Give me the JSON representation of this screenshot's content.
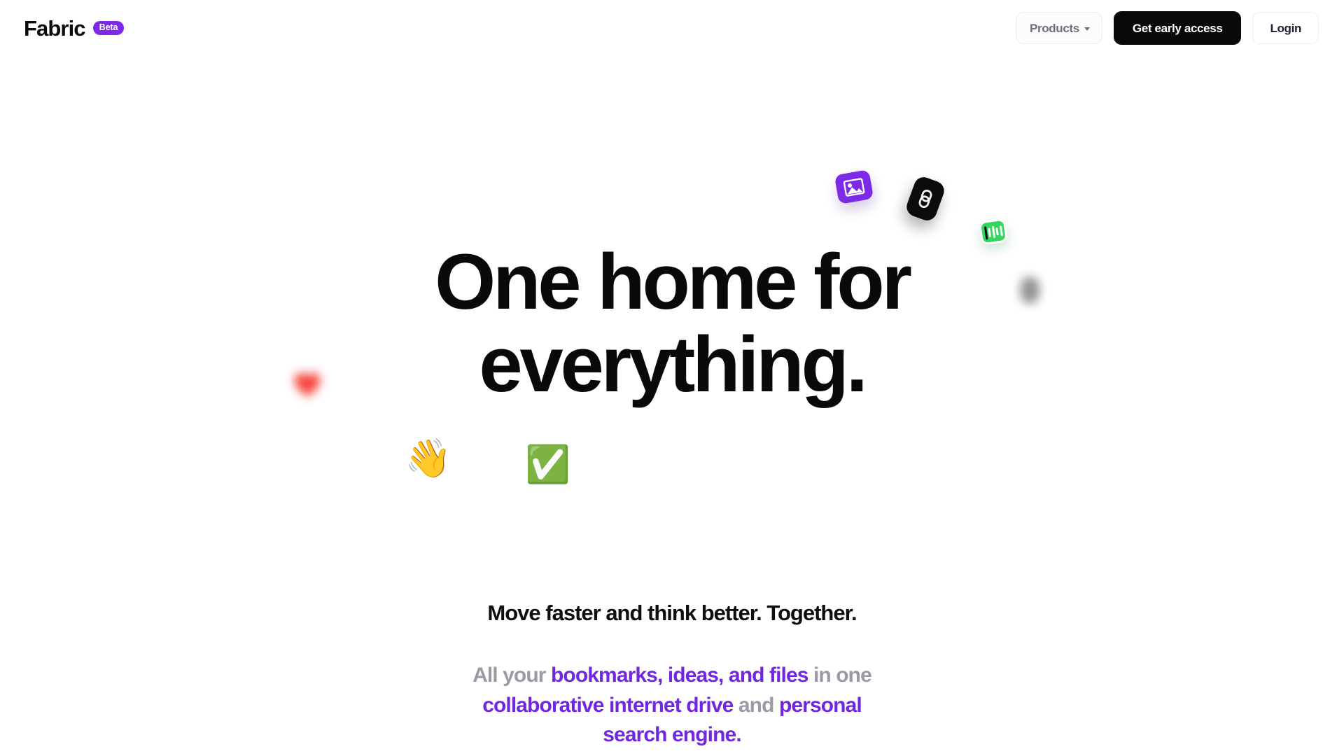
{
  "brand": {
    "name": "Fabric",
    "badge": "Beta"
  },
  "nav": {
    "products_label": "Products",
    "products_caret_icon": "chevron-down-icon",
    "cta_label": "Get early access",
    "login_label": "Login"
  },
  "hero": {
    "headline_line1": "One home for",
    "headline_line2": "everything.",
    "subheadline": "Move faster and think better. Together.",
    "lede": {
      "part1": "All your ",
      "hl1": "bookmarks, ideas, and files",
      "part2": " in one ",
      "hl2": "collaborative internet drive",
      "part3": " and ",
      "hl3": "personal search engine",
      "part4": "."
    }
  },
  "decorations": [
    {
      "name": "image-tile-icon",
      "type": "image"
    },
    {
      "name": "link-tile-icon",
      "type": "link"
    },
    {
      "name": "bars-tile-icon",
      "type": "bars"
    },
    {
      "name": "blurred-dark-tile-icon",
      "type": "blur-dark"
    },
    {
      "name": "blurred-heart-icon",
      "type": "blur-heart"
    },
    {
      "name": "waving-hand-emoji",
      "glyph": "👋"
    },
    {
      "name": "check-mark-button-emoji",
      "glyph": "✅"
    }
  ],
  "colors": {
    "accent_purple": "#7127e0",
    "badge_purple": "#7d2ae8",
    "cta_black": "#09090b",
    "muted_gray": "#9a9aa4",
    "green": "#34d65f",
    "heart_red": "#f5352c",
    "page_bg": "#ffffff"
  }
}
